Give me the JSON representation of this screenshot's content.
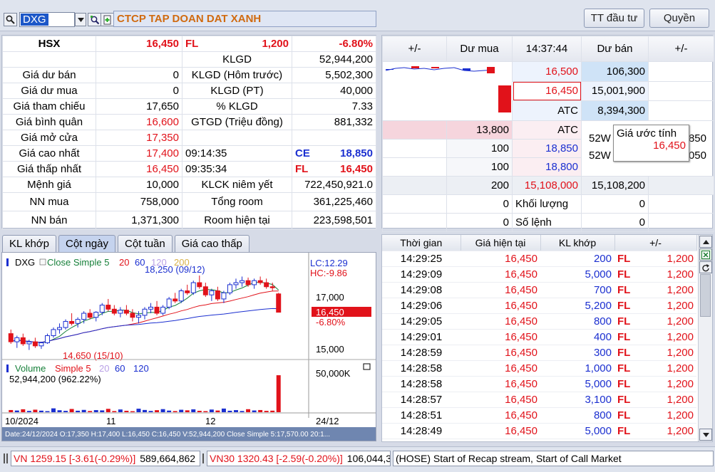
{
  "toolbar": {
    "symbol": "DXG",
    "company_name": "CTCP TAP DOAN DAT XANH",
    "btn_tt_dau_tu": "TT đầu tư",
    "btn_quyen": "Quyền"
  },
  "info": {
    "exchange": "HSX",
    "price": "16,450",
    "fl_tag": "FL",
    "change": "1,200",
    "change_pct": "-6.80%",
    "rows_left": [
      {
        "label": "Giá dư bán",
        "value": "0"
      },
      {
        "label": "Giá dư mua",
        "value": "0"
      },
      {
        "label": "Giá tham chiếu",
        "value": "17,650"
      },
      {
        "label": "Giá bình quân",
        "value": "16,600"
      },
      {
        "label": "Giá mở cửa",
        "value": "17,350"
      },
      {
        "label": "Giá cao nhất",
        "value": "17,400"
      },
      {
        "label": "Giá thấp nhất",
        "value": "16,450"
      },
      {
        "label": "Mệnh giá",
        "value": "10,000"
      },
      {
        "label": "NN mua",
        "value": "758,000"
      },
      {
        "label": "NN bán",
        "value": "1,371,300"
      }
    ],
    "klgd_label": "KLGD",
    "klgd_value": "52,944,200",
    "klgd_prev_label": "KLGD (Hôm trước)",
    "klgd_prev_value": "5,502,300",
    "klgd_pt_label": "KLGD (PT)",
    "klgd_pt_value": "40,000",
    "pct_klgd_label": "% KLGD",
    "pct_klgd_value": "7.33",
    "gtgd_label": "GTGD (Triệu đồng)",
    "gtgd_value": "881,332",
    "time_ce": "09:14:35",
    "ce_tag": "CE",
    "ce_value": "18,850",
    "time_fl": "09:35:34",
    "fl_value": "16,450",
    "klck_label": "KLCK niêm yết",
    "klck_value": "722,450,921.0",
    "tong_room_label": "Tổng room",
    "tong_room_value": "361,225,460",
    "room_ht_label": "Room hiện tại",
    "room_ht_value": "223,598,501"
  },
  "depth": {
    "headers": [
      "+/-",
      "Dư mua",
      "14:37:44",
      "Dư bán",
      "+/-"
    ],
    "ask": [
      {
        "price": "16,500",
        "vol": "106,300"
      },
      {
        "price": "16,450",
        "vol": "15,001,900"
      },
      {
        "price": "ATC",
        "vol": "8,394,300"
      }
    ],
    "bid": [
      {
        "vol": "13,800",
        "price": "ATC"
      },
      {
        "vol": "100",
        "price": "18,850"
      },
      {
        "vol": "100",
        "price": "18,800"
      }
    ],
    "tooltip_label": "Giá ước tính",
    "tooltip_value": "16,450",
    "w52_a": "52W",
    "w52_a_val": ",850",
    "w52_b": "52W",
    "w52_b_val": ",050",
    "sum_row": {
      "bid_vol": "200",
      "match": "15,108,000",
      "ask_vol": "15,108,200"
    },
    "khoi_luong_label": "Khối lượng",
    "khoi_luong_left": "0",
    "khoi_luong_right": "0",
    "so_lenh_label": "Số lệnh",
    "so_lenh_left": "0",
    "so_lenh_right": "0"
  },
  "tabs": [
    "KL khớp",
    "Cột ngày",
    "Cột tuần",
    "Giá cao thấp"
  ],
  "chart_panel": {
    "legend_symbol": "DXG",
    "legend_ma": "Close Simple 5",
    "legend_periods": [
      "20",
      "60",
      "120",
      "200"
    ],
    "lc": "LC:12.29",
    "hc": "HC:-9.86",
    "high_note": "18,250 (09/12)",
    "low_note": "14,650 (15/10)",
    "tick_17000": "17,000",
    "tick_15000": "15,000",
    "last_price": "16,450",
    "last_pct": "-6.80%",
    "vol_legend": "Volume",
    "vol_ma": "Simple 5",
    "vol_periods": [
      "20",
      "60",
      "120"
    ],
    "vol_value": "52,944,200 (962.22%)",
    "vol_tick": "50,000K",
    "x_labels": [
      "10/2024",
      "11",
      "12",
      "24/12"
    ],
    "footer": "Date:24/12/2024  O:17,350  H:17,400  L:16,450  C:16,450  V:52,944,200  Close Simple 5:17,570.00  20:1..."
  },
  "chart_data": {
    "type": "candlestick",
    "ylim": [
      14200,
      18600
    ],
    "candles": [
      {
        "o": 15400,
        "h": 15600,
        "l": 14900,
        "c": 15000
      },
      {
        "o": 15000,
        "h": 15300,
        "l": 14700,
        "c": 15200
      },
      {
        "o": 15200,
        "h": 15400,
        "l": 14800,
        "c": 14900
      },
      {
        "o": 14900,
        "h": 15100,
        "l": 14600,
        "c": 15000
      },
      {
        "o": 15000,
        "h": 15200,
        "l": 14700,
        "c": 14800
      },
      {
        "o": 14800,
        "h": 15000,
        "l": 14650,
        "c": 14950
      },
      {
        "o": 14950,
        "h": 15400,
        "l": 14900,
        "c": 15300
      },
      {
        "o": 15300,
        "h": 15700,
        "l": 15200,
        "c": 15600
      },
      {
        "o": 15600,
        "h": 15900,
        "l": 15400,
        "c": 15700
      },
      {
        "o": 15700,
        "h": 16100,
        "l": 15600,
        "c": 16000
      },
      {
        "o": 16000,
        "h": 16400,
        "l": 15800,
        "c": 15900
      },
      {
        "o": 15900,
        "h": 16200,
        "l": 15700,
        "c": 16100
      },
      {
        "o": 16100,
        "h": 16500,
        "l": 15900,
        "c": 16400
      },
      {
        "o": 16400,
        "h": 16600,
        "l": 16100,
        "c": 16200
      },
      {
        "o": 16200,
        "h": 16500,
        "l": 16000,
        "c": 16450
      },
      {
        "o": 16450,
        "h": 16900,
        "l": 16300,
        "c": 16800
      },
      {
        "o": 16800,
        "h": 17100,
        "l": 16500,
        "c": 16600
      },
      {
        "o": 16600,
        "h": 16800,
        "l": 16300,
        "c": 16400
      },
      {
        "o": 16400,
        "h": 16700,
        "l": 16200,
        "c": 16550
      },
      {
        "o": 16550,
        "h": 16800,
        "l": 16300,
        "c": 16400
      },
      {
        "o": 16400,
        "h": 16600,
        "l": 16000,
        "c": 16200
      },
      {
        "o": 16200,
        "h": 16500,
        "l": 15900,
        "c": 16300
      },
      {
        "o": 16300,
        "h": 16700,
        "l": 16100,
        "c": 16600
      },
      {
        "o": 16600,
        "h": 16900,
        "l": 16400,
        "c": 16700
      },
      {
        "o": 16700,
        "h": 17000,
        "l": 16300,
        "c": 16400
      },
      {
        "o": 16400,
        "h": 16800,
        "l": 16300,
        "c": 16700
      },
      {
        "o": 16700,
        "h": 17200,
        "l": 16600,
        "c": 17100
      },
      {
        "o": 17100,
        "h": 17400,
        "l": 16900,
        "c": 17000
      },
      {
        "o": 17000,
        "h": 17600,
        "l": 16900,
        "c": 17500
      },
      {
        "o": 17500,
        "h": 17800,
        "l": 17300,
        "c": 17400
      },
      {
        "o": 17400,
        "h": 18000,
        "l": 17300,
        "c": 17900
      },
      {
        "o": 17900,
        "h": 18250,
        "l": 17600,
        "c": 17700
      },
      {
        "o": 17700,
        "h": 17900,
        "l": 17200,
        "c": 17300
      },
      {
        "o": 17300,
        "h": 17600,
        "l": 17000,
        "c": 17500
      },
      {
        "o": 17500,
        "h": 17700,
        "l": 17000,
        "c": 17100
      },
      {
        "o": 17100,
        "h": 17500,
        "l": 16900,
        "c": 17400
      },
      {
        "o": 17400,
        "h": 17900,
        "l": 17300,
        "c": 17800
      },
      {
        "o": 17800,
        "h": 18100,
        "l": 17600,
        "c": 17900
      },
      {
        "o": 17900,
        "h": 18200,
        "l": 17700,
        "c": 18000
      },
      {
        "o": 18000,
        "h": 18150,
        "l": 17700,
        "c": 17800
      },
      {
        "o": 17800,
        "h": 18100,
        "l": 17600,
        "c": 18000
      },
      {
        "o": 18000,
        "h": 18200,
        "l": 17800,
        "c": 17900
      },
      {
        "o": 17900,
        "h": 18100,
        "l": 17600,
        "c": 17700
      },
      {
        "o": 17700,
        "h": 17900,
        "l": 17500,
        "c": 17650
      },
      {
        "o": 17350,
        "h": 17400,
        "l": 16450,
        "c": 16450
      }
    ],
    "volumes": [
      3.1,
      2.4,
      4.2,
      1.8,
      3.6,
      2.2,
      1.5,
      5.5,
      2.8,
      1.9,
      4.6,
      2.1,
      3.3,
      1.7,
      3.0,
      2.6,
      4.8,
      1.6,
      3.9,
      2.0,
      1.4,
      5.0,
      3.2,
      1.8,
      2.9,
      4.4,
      2.3,
      1.6,
      3.5,
      2.7,
      4.1,
      2.0,
      1.5,
      3.8,
      2.4,
      5.2,
      2.1,
      3.0,
      1.7,
      4.3,
      2.5,
      3.1,
      1.9,
      2.2,
      52.9
    ]
  },
  "trades": {
    "headers": [
      "Thời gian",
      "Giá hiện tại",
      "KL khớp",
      "+/-"
    ],
    "rows": [
      {
        "time": "14:29:25",
        "price": "16,450",
        "vol": "200",
        "tag": "FL",
        "chg": "1,200"
      },
      {
        "time": "14:29:09",
        "price": "16,450",
        "vol": "5,000",
        "tag": "FL",
        "chg": "1,200"
      },
      {
        "time": "14:29:08",
        "price": "16,450",
        "vol": "700",
        "tag": "FL",
        "chg": "1,200"
      },
      {
        "time": "14:29:06",
        "price": "16,450",
        "vol": "5,200",
        "tag": "FL",
        "chg": "1,200"
      },
      {
        "time": "14:29:05",
        "price": "16,450",
        "vol": "800",
        "tag": "FL",
        "chg": "1,200"
      },
      {
        "time": "14:29:01",
        "price": "16,450",
        "vol": "400",
        "tag": "FL",
        "chg": "1,200"
      },
      {
        "time": "14:28:59",
        "price": "16,450",
        "vol": "300",
        "tag": "FL",
        "chg": "1,200"
      },
      {
        "time": "14:28:58",
        "price": "16,450",
        "vol": "1,000",
        "tag": "FL",
        "chg": "1,200"
      },
      {
        "time": "14:28:58",
        "price": "16,450",
        "vol": "5,000",
        "tag": "FL",
        "chg": "1,200"
      },
      {
        "time": "14:28:57",
        "price": "16,450",
        "vol": "3,100",
        "tag": "FL",
        "chg": "1,200"
      },
      {
        "time": "14:28:51",
        "price": "16,450",
        "vol": "800",
        "tag": "FL",
        "chg": "1,200"
      },
      {
        "time": "14:28:49",
        "price": "16,450",
        "vol": "5,000",
        "tag": "FL",
        "chg": "1,200"
      }
    ]
  },
  "statusbar": {
    "vn_index": "VN 1259.15 [-3.61(-0.29%)]",
    "vn_vol": "589,664,862",
    "vn30": "VN30 1320.43 [-2.59(-0.20%)]",
    "vn30_vol": "106,044,3",
    "message": "(HOSE) Start of Recap stream, Start of Call Market"
  },
  "colors": {
    "up": "#1b2fd0",
    "down": "#e1121a",
    "accent": "#c5d3ee"
  }
}
